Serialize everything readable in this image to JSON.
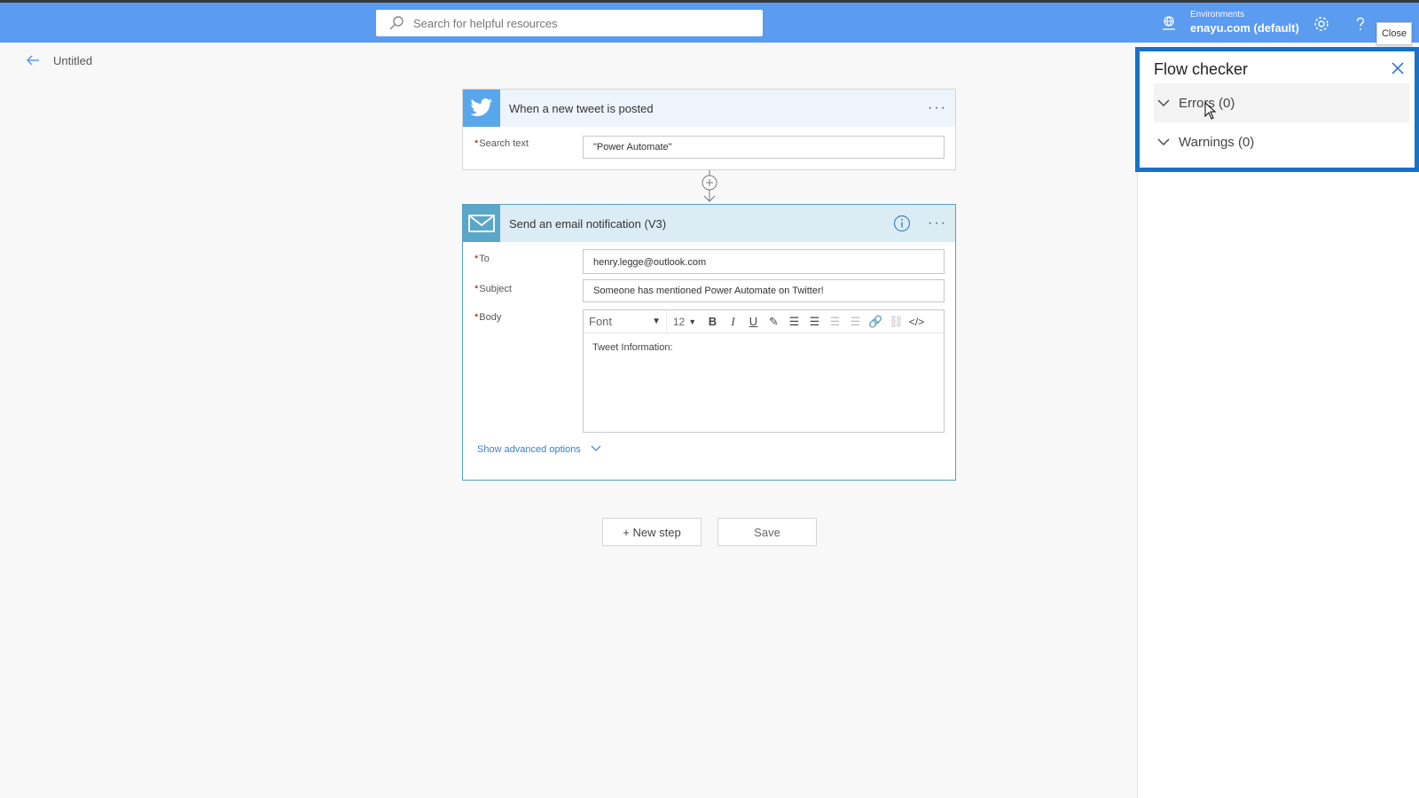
{
  "topbar": {
    "search_placeholder": "Search for helpful resources",
    "environment_label": "Environments",
    "environment_value": "enayu.com (default)",
    "close_tooltip": "Close"
  },
  "header": {
    "title": "Untitled"
  },
  "trigger": {
    "title": "When a new tweet is posted",
    "more": "···",
    "search_text_label": "Search text",
    "search_text_value": "\"Power Automate\""
  },
  "action": {
    "title": "Send an email notification (V3)",
    "more": "···",
    "to_label": "To",
    "to_value": "henry.legge@outlook.com",
    "subject_label": "Subject",
    "subject_value": "Someone has mentioned Power Automate on Twitter!",
    "body_label": "Body",
    "font_label": "Font",
    "font_size": "12",
    "body_content": "Tweet Information:",
    "advanced_options": "Show advanced options"
  },
  "buttons": {
    "new_step": "+ New step",
    "save": "Save"
  },
  "flow_checker": {
    "title": "Flow checker",
    "errors": "Errors (0)",
    "warnings": "Warnings (0)"
  },
  "colors": {
    "topbar": "#5b9bf0",
    "highlight": "#1672c9",
    "twitter": "#58a7ea",
    "mail": "#5aa7c7",
    "link": "#3b7fc4"
  }
}
